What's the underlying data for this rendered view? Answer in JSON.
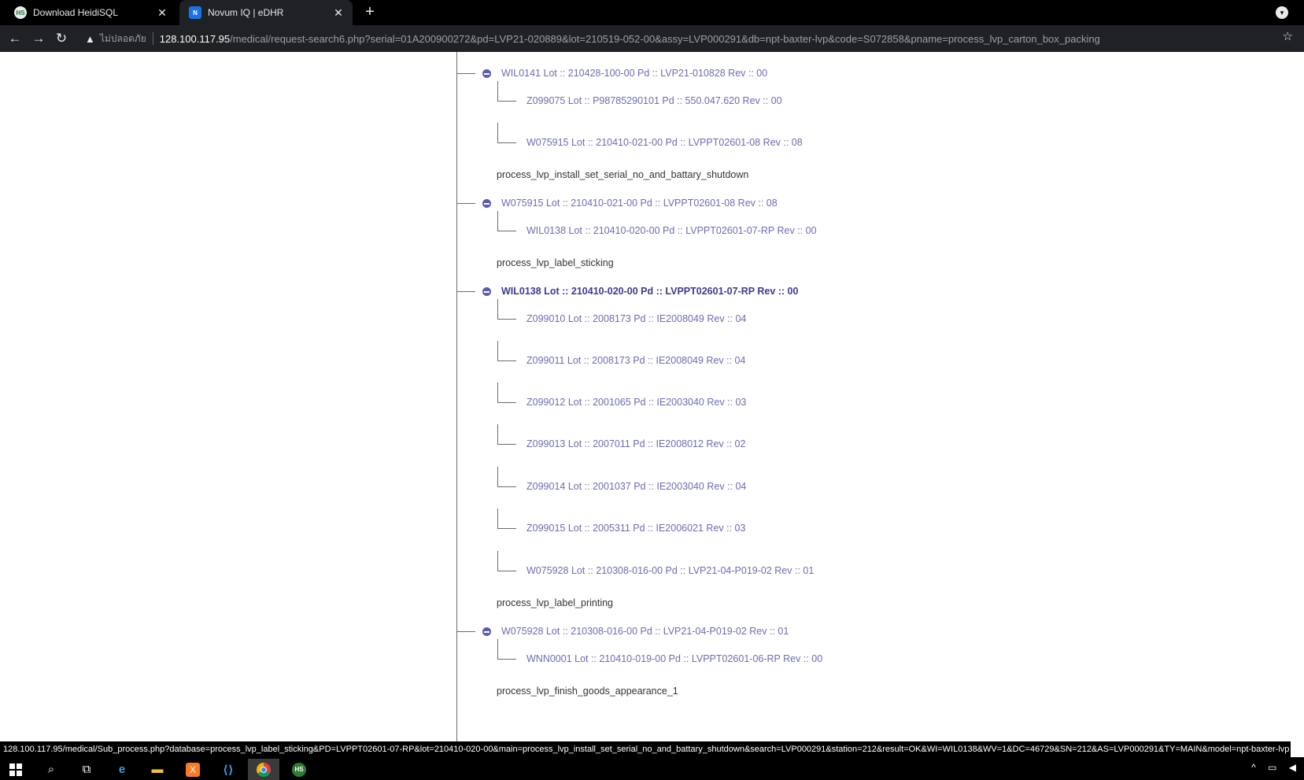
{
  "browser": {
    "tabs": [
      {
        "title": "Download HeidiSQL",
        "favicon": "heidisql-icon"
      },
      {
        "title": "Novum IQ | eDHR",
        "favicon": "novum-icon"
      }
    ],
    "security_label": "ไม่ปลอดภัย",
    "url_host": "128.100.117.95",
    "url_path": "/medical/request-search6.php?serial=01A200900272&pd=LVP21-020889&lot=210519-052-00&assy=LVP000291&db=npt-baxter-lvp&code=S072858&pname=process_lvp_carton_box_packing"
  },
  "tree": {
    "groups": [
      {
        "parent": "WIL0141 Lot :: 210428-100-00 Pd :: LVP21-010828 Rev :: 00",
        "children": [
          "Z099075 Lot :: P98785290101 Pd :: 550.047.620 Rev :: 00",
          "W075915 Lot :: 210410-021-00 Pd :: LVPPT02601-08 Rev :: 08"
        ],
        "process": "process_lvp_install_set_serial_no_and_battary_shutdown"
      },
      {
        "parent": "W075915 Lot :: 210410-021-00 Pd :: LVPPT02601-08 Rev :: 08",
        "children": [
          "WIL0138 Lot :: 210410-020-00 Pd :: LVPPT02601-07-RP Rev :: 00"
        ],
        "process": "process_lvp_label_sticking"
      },
      {
        "parent": "WIL0138 Lot :: 210410-020-00 Pd :: LVPPT02601-07-RP Rev :: 00",
        "children": [
          "Z099010 Lot :: 2008173 Pd :: IE2008049 Rev :: 04",
          "Z099011 Lot :: 2008173 Pd :: IE2008049 Rev :: 04",
          "Z099012 Lot :: 2001065 Pd :: IE2003040 Rev :: 03",
          "Z099013 Lot :: 2007011 Pd :: IE2008012 Rev :: 02",
          "Z099014 Lot :: 2001037 Pd :: IE2003040 Rev :: 04",
          "Z099015 Lot :: 2005311 Pd :: IE2006021 Rev :: 03",
          "W075928 Lot :: 210308-016-00 Pd :: LVP21-04-P019-02 Rev :: 01"
        ],
        "process": "process_lvp_label_printing"
      },
      {
        "parent": "W075928 Lot :: 210308-016-00 Pd :: LVP21-04-P019-02 Rev :: 01",
        "children": [
          "WNN0001 Lot :: 210410-019-00 Pd :: LVPPT02601-06-RP Rev :: 00"
        ],
        "process": "process_lvp_finish_goods_appearance_1"
      }
    ]
  },
  "status_url": "128.100.117.95/medical/Sub_process.php?database=process_lvp_label_sticking&PD=LVPPT02601-07-RP&lot=210410-020-00&main=process_lvp_install_set_serial_no_and_battary_shutdown&search=LVP000291&station=212&result=OK&WI=WIL0138&WV=1&DC=46729&SN=212&AS=LVP000291&TY=MAIN&model=npt-baxter-lvp",
  "taskbar": {
    "icons": [
      "windows-start-icon",
      "search-icon",
      "task-view-icon",
      "edge-icon",
      "file-explorer-icon",
      "xampp-icon",
      "vscode-icon",
      "chrome-icon",
      "heidisql-icon"
    ]
  }
}
